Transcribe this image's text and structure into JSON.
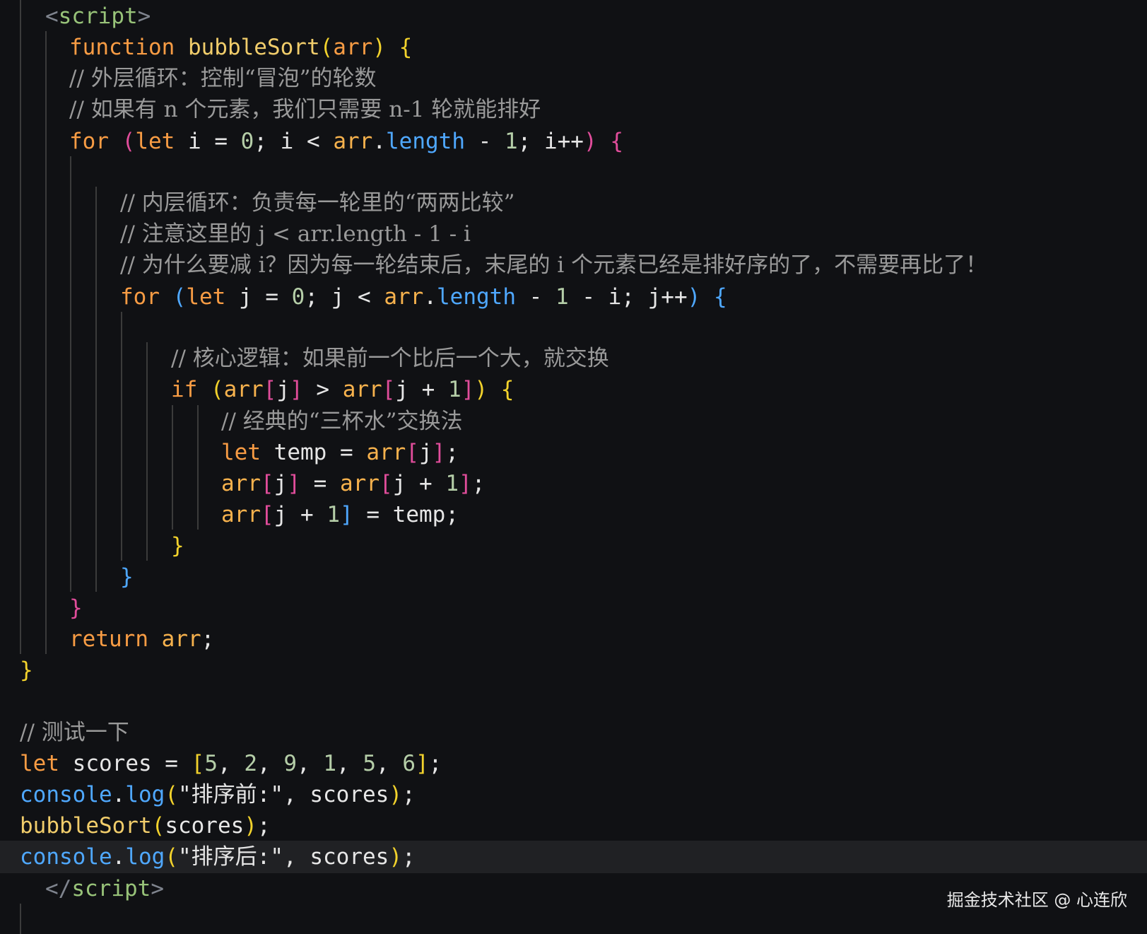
{
  "editor": {
    "lines": [
      {
        "tokens": [
          {
            "t": "<",
            "c": "t-tag"
          },
          {
            "t": "script",
            "c": "t-tagname"
          },
          {
            "t": ">",
            "c": "t-tag"
          }
        ]
      },
      {
        "tokens": [
          {
            "t": "function",
            "c": "t-kw"
          },
          {
            "t": " ",
            "c": "t-plain"
          },
          {
            "t": "bubbleSort",
            "c": "t-fn"
          },
          {
            "t": "(",
            "c": "b-yellow"
          },
          {
            "t": "arr",
            "c": "t-param"
          },
          {
            "t": ")",
            "c": "b-yellow"
          },
          {
            "t": " ",
            "c": "t-plain"
          },
          {
            "t": "{",
            "c": "b-yellow"
          }
        ]
      },
      {
        "tokens": [
          {
            "t": "// 外层循环：控制“冒泡”的轮数",
            "c": "t-comment"
          }
        ]
      },
      {
        "tokens": [
          {
            "t": "// 如果有 n 个元素，我们只需要 n-1 轮就能排好",
            "c": "t-comment"
          }
        ]
      },
      {
        "tokens": [
          {
            "t": "for",
            "c": "t-kw"
          },
          {
            "t": " ",
            "c": "t-plain"
          },
          {
            "t": "(",
            "c": "b-pink"
          },
          {
            "t": "let",
            "c": "t-kw"
          },
          {
            "t": " i = ",
            "c": "t-plain"
          },
          {
            "t": "0",
            "c": "t-num"
          },
          {
            "t": "; i < ",
            "c": "t-plain"
          },
          {
            "t": "arr",
            "c": "t-var"
          },
          {
            "t": ".",
            "c": "t-plain"
          },
          {
            "t": "length",
            "c": "t-prop"
          },
          {
            "t": " - ",
            "c": "t-plain"
          },
          {
            "t": "1",
            "c": "t-num"
          },
          {
            "t": "; i++",
            "c": "t-plain"
          },
          {
            "t": ")",
            "c": "b-pink"
          },
          {
            "t": " ",
            "c": "t-plain"
          },
          {
            "t": "{",
            "c": "b-pink"
          }
        ]
      },
      {
        "tokens": []
      },
      {
        "tokens": [
          {
            "t": "// 内层循环：负责每一轮里的“两两比较”",
            "c": "t-comment"
          }
        ]
      },
      {
        "tokens": [
          {
            "t": "// 注意这里的 j < arr.length - 1 - i",
            "c": "t-comment"
          }
        ]
      },
      {
        "tokens": [
          {
            "t": "// 为什么要减 i？因为每一轮结束后，末尾的 i 个元素已经是排好序的了，不需要再比了！",
            "c": "t-comment"
          }
        ]
      },
      {
        "tokens": [
          {
            "t": "for",
            "c": "t-kw"
          },
          {
            "t": " ",
            "c": "t-plain"
          },
          {
            "t": "(",
            "c": "b-blue"
          },
          {
            "t": "let",
            "c": "t-kw"
          },
          {
            "t": " j = ",
            "c": "t-plain"
          },
          {
            "t": "0",
            "c": "t-num"
          },
          {
            "t": "; j < ",
            "c": "t-plain"
          },
          {
            "t": "arr",
            "c": "t-var"
          },
          {
            "t": ".",
            "c": "t-plain"
          },
          {
            "t": "length",
            "c": "t-prop"
          },
          {
            "t": " - ",
            "c": "t-plain"
          },
          {
            "t": "1",
            "c": "t-num"
          },
          {
            "t": " - i; j++",
            "c": "t-plain"
          },
          {
            "t": ")",
            "c": "b-blue"
          },
          {
            "t": " ",
            "c": "t-plain"
          },
          {
            "t": "{",
            "c": "b-blue"
          }
        ]
      },
      {
        "tokens": []
      },
      {
        "tokens": [
          {
            "t": "// 核心逻辑：如果前一个比后一个大，就交换",
            "c": "t-comment"
          }
        ]
      },
      {
        "tokens": [
          {
            "t": "if",
            "c": "t-kw"
          },
          {
            "t": " ",
            "c": "t-plain"
          },
          {
            "t": "(",
            "c": "b-yellow"
          },
          {
            "t": "arr",
            "c": "t-var"
          },
          {
            "t": "[",
            "c": "b-pink"
          },
          {
            "t": "j",
            "c": "t-plain"
          },
          {
            "t": "]",
            "c": "b-pink"
          },
          {
            "t": " > ",
            "c": "t-plain"
          },
          {
            "t": "arr",
            "c": "t-var"
          },
          {
            "t": "[",
            "c": "b-pink"
          },
          {
            "t": "j + ",
            "c": "t-plain"
          },
          {
            "t": "1",
            "c": "t-num"
          },
          {
            "t": "]",
            "c": "b-pink"
          },
          {
            "t": ")",
            "c": "b-yellow"
          },
          {
            "t": " ",
            "c": "t-plain"
          },
          {
            "t": "{",
            "c": "b-yellow"
          }
        ]
      },
      {
        "tokens": [
          {
            "t": "// 经典的“三杯水”交换法",
            "c": "t-comment"
          }
        ]
      },
      {
        "tokens": [
          {
            "t": "let",
            "c": "t-kw"
          },
          {
            "t": " temp = ",
            "c": "t-plain"
          },
          {
            "t": "arr",
            "c": "t-var"
          },
          {
            "t": "[",
            "c": "b-pink"
          },
          {
            "t": "j",
            "c": "t-plain"
          },
          {
            "t": "]",
            "c": "b-pink"
          },
          {
            "t": ";",
            "c": "t-plain"
          }
        ]
      },
      {
        "tokens": [
          {
            "t": "arr",
            "c": "t-var"
          },
          {
            "t": "[",
            "c": "b-pink"
          },
          {
            "t": "j",
            "c": "t-plain"
          },
          {
            "t": "]",
            "c": "b-pink"
          },
          {
            "t": " = ",
            "c": "t-plain"
          },
          {
            "t": "arr",
            "c": "t-var"
          },
          {
            "t": "[",
            "c": "b-pink"
          },
          {
            "t": "j + ",
            "c": "t-plain"
          },
          {
            "t": "1",
            "c": "t-num"
          },
          {
            "t": "]",
            "c": "b-pink"
          },
          {
            "t": ";",
            "c": "t-plain"
          }
        ]
      },
      {
        "tokens": [
          {
            "t": "arr",
            "c": "t-var"
          },
          {
            "t": "[",
            "c": "b-pink"
          },
          {
            "t": "j + ",
            "c": "t-plain"
          },
          {
            "t": "1",
            "c": "t-num"
          },
          {
            "t": "]",
            "c": "b-blue"
          },
          {
            "t": " = temp;",
            "c": "t-plain"
          }
        ]
      },
      {
        "tokens": [
          {
            "t": "}",
            "c": "b-yellow"
          }
        ]
      },
      {
        "tokens": [
          {
            "t": "}",
            "c": "b-blue"
          }
        ]
      },
      {
        "tokens": [
          {
            "t": "}",
            "c": "b-pink"
          }
        ]
      },
      {
        "tokens": [
          {
            "t": "return",
            "c": "t-kw"
          },
          {
            "t": " ",
            "c": "t-plain"
          },
          {
            "t": "arr",
            "c": "t-var"
          },
          {
            "t": ";",
            "c": "t-plain"
          }
        ]
      },
      {
        "tokens": [
          {
            "t": "}",
            "c": "b-yellow"
          }
        ]
      },
      {
        "tokens": []
      },
      {
        "tokens": [
          {
            "t": "// 测试一下",
            "c": "t-comment"
          }
        ]
      },
      {
        "tokens": [
          {
            "t": "let",
            "c": "t-kw"
          },
          {
            "t": " scores = ",
            "c": "t-plain"
          },
          {
            "t": "[",
            "c": "b-yellow"
          },
          {
            "t": "5",
            "c": "t-num"
          },
          {
            "t": ", ",
            "c": "t-plain"
          },
          {
            "t": "2",
            "c": "t-num"
          },
          {
            "t": ", ",
            "c": "t-plain"
          },
          {
            "t": "9",
            "c": "t-num"
          },
          {
            "t": ", ",
            "c": "t-plain"
          },
          {
            "t": "1",
            "c": "t-num"
          },
          {
            "t": ", ",
            "c": "t-plain"
          },
          {
            "t": "5",
            "c": "t-num"
          },
          {
            "t": ", ",
            "c": "t-plain"
          },
          {
            "t": "6",
            "c": "t-num"
          },
          {
            "t": "]",
            "c": "b-yellow"
          },
          {
            "t": ";",
            "c": "t-plain"
          }
        ]
      },
      {
        "tokens": [
          {
            "t": "console",
            "c": "t-method"
          },
          {
            "t": ".",
            "c": "t-plain"
          },
          {
            "t": "log",
            "c": "t-method"
          },
          {
            "t": "(",
            "c": "b-yellow"
          },
          {
            "t": "\"排序前:\"",
            "c": "t-str"
          },
          {
            "t": ", scores",
            "c": "t-plain"
          },
          {
            "t": ")",
            "c": "b-yellow"
          },
          {
            "t": ";",
            "c": "t-plain"
          }
        ]
      },
      {
        "tokens": [
          {
            "t": "bubbleSort",
            "c": "t-fn"
          },
          {
            "t": "(",
            "c": "b-yellow"
          },
          {
            "t": "scores",
            "c": "t-plain"
          },
          {
            "t": ")",
            "c": "b-yellow"
          },
          {
            "t": ";",
            "c": "t-plain"
          }
        ]
      },
      {
        "tokens": [
          {
            "t": "console",
            "c": "t-method"
          },
          {
            "t": ".",
            "c": "t-plain"
          },
          {
            "t": "log",
            "c": "t-method"
          },
          {
            "t": "(",
            "c": "b-yellow"
          },
          {
            "t": "\"排序后:\"",
            "c": "t-str"
          },
          {
            "t": ", scores",
            "c": "t-plain"
          },
          {
            "t": ")",
            "c": "b-yellow"
          },
          {
            "t": ";",
            "c": "t-plain"
          }
        ]
      },
      {
        "tokens": [
          {
            "t": "</",
            "c": "t-tag"
          },
          {
            "t": "script",
            "c": "t-tagname"
          },
          {
            "t": ">",
            "c": "t-tag"
          }
        ]
      }
    ]
  },
  "watermark": {
    "text": "掘金技术社区 @ 心连欣"
  }
}
